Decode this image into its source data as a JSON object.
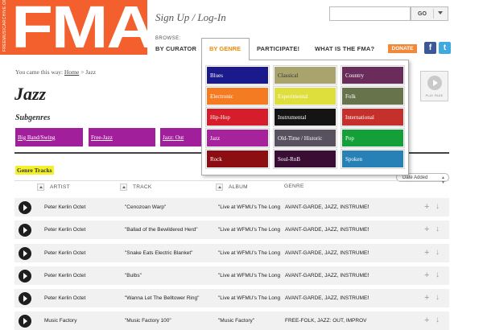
{
  "header": {
    "logo_text": "FMA",
    "logo_vertical": "FREEMUSICARCHIVE.ORG",
    "signup": "Sign Up / Log-In",
    "search_placeholder": "",
    "go_label": "GO"
  },
  "nav": {
    "browse_label": "BROWSE:",
    "by_curator": "BY CURATOR",
    "by_genre": "BY GENRE",
    "participate": "PARTICIPATE!",
    "what_is": "WHAT IS THE FMA?",
    "donate": "DONATE",
    "facebook": "f",
    "twitter": "t"
  },
  "breadcrumb": {
    "prefix": "You came this way:",
    "home": "Home",
    "sep": ">",
    "current": "Jazz"
  },
  "page_title": "Jazz",
  "play_all_label": "PLAY PAGE",
  "subgenres": {
    "title": "Subgenres",
    "items": [
      "Big Band/Swing",
      "Free-Jazz",
      "Jazz: Out"
    ]
  },
  "tracks_title": "Genre Tracks",
  "sort": {
    "selected": "Date Added"
  },
  "columns": {
    "artist": "ARTIST",
    "track": "TRACK",
    "album": "ALBUM",
    "genre": "GENRE"
  },
  "rows": [
    {
      "artist": "Peter Kerlin Octet",
      "track": "\"Cenozoan Warp\"",
      "album": "\"Live at WFMU's The Long",
      "genre": "AVANT-GARDE, JAZZ, INSTRUMEN"
    },
    {
      "artist": "Peter Kerlin Octet",
      "track": "\"Ballad of the Bewildered Herd\"",
      "album": "\"Live at WFMU's The Long",
      "genre": "AVANT-GARDE, JAZZ, INSTRUMEN"
    },
    {
      "artist": "Peter Kerlin Octet",
      "track": "\"Snake Eats Electric Blanket\"",
      "album": "\"Live at WFMU's The Long",
      "genre": "AVANT-GARDE, JAZZ, INSTRUMEN"
    },
    {
      "artist": "Peter Kerlin Octet",
      "track": "\"Bulbs\"",
      "album": "\"Live at WFMU's The Long",
      "genre": "AVANT-GARDE, JAZZ, INSTRUMEN"
    },
    {
      "artist": "Peter Kerlin Octet",
      "track": "\"Wanna Let The Belltower Ring\"",
      "album": "\"Live at WFMU's The Long",
      "genre": "AVANT-GARDE, JAZZ, INSTRUMEN"
    },
    {
      "artist": "Music Factory",
      "track": "\"Music Factory 100\"",
      "album": "\"Music Factory\"",
      "genre": "FREE-FOLK, JAZZ: OUT, IMPROV"
    }
  ],
  "genre_menu": [
    {
      "label": "Blues",
      "color": "#1a1a8c"
    },
    {
      "label": "Classical",
      "color": "#a9a46d"
    },
    {
      "label": "Country",
      "color": "#6a2c5a"
    },
    {
      "label": "Electronic",
      "color": "#f57b23"
    },
    {
      "label": "Experimental",
      "color": "#dede3c"
    },
    {
      "label": "Folk",
      "color": "#67744b"
    },
    {
      "label": "Hip-Hop",
      "color": "#d61d2b"
    },
    {
      "label": "Instrumental",
      "color": "#141414"
    },
    {
      "label": "International",
      "color": "#c6302c"
    },
    {
      "label": "Jazz",
      "color": "#a7239c"
    },
    {
      "label": "Old-Time / Historic",
      "color": "#58515f"
    },
    {
      "label": "Pop",
      "color": "#14a038"
    },
    {
      "label": "Rock",
      "color": "#8c0e12"
    },
    {
      "label": "Soul-RnB",
      "color": "#3a0d35"
    },
    {
      "label": "Spoken",
      "color": "#2781b6"
    }
  ],
  "colors": {
    "brand": "#f3602e",
    "subgenre": "#a21f9c",
    "highlight": "#f4f02a",
    "active_tab": "#f08a00"
  }
}
